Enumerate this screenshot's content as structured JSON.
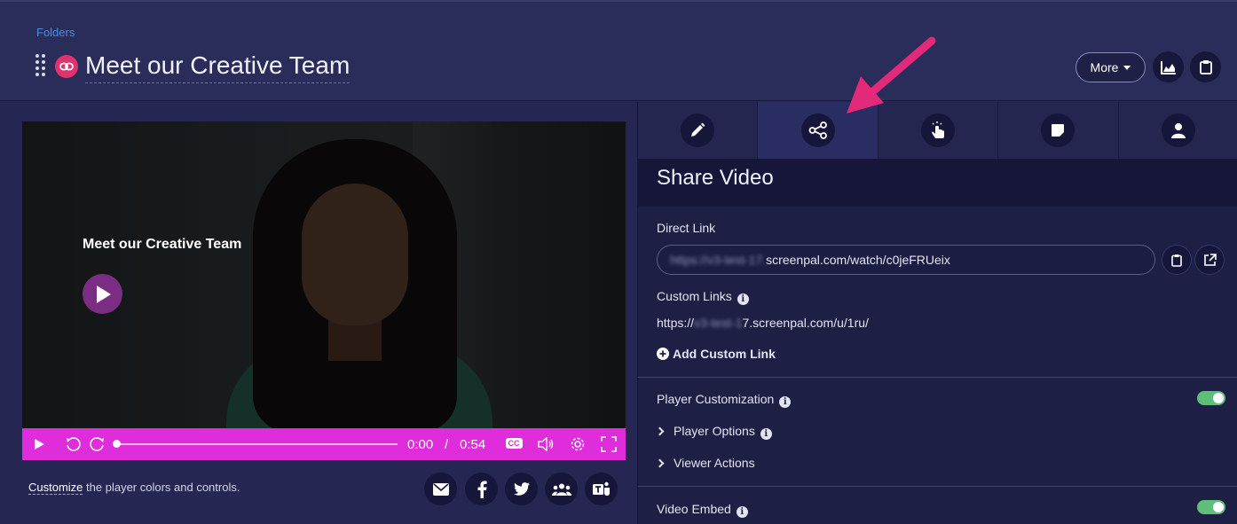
{
  "header": {
    "breadcrumb": "Folders",
    "title": "Meet our Creative Team",
    "more_label": "More"
  },
  "player": {
    "overlay_title": "Meet our Creative Team",
    "current_time": "0:00",
    "separator": "/",
    "duration": "0:54",
    "progress": 0,
    "cc_label": "CC",
    "bar_color": "#e02ddc"
  },
  "left_footer": {
    "customize_link": "Customize",
    "customize_rest": " the player colors and controls."
  },
  "share_buttons": [
    "email-icon",
    "facebook-icon",
    "twitter-icon",
    "group-icon",
    "teams-icon"
  ],
  "tabs": [
    {
      "icon": "pencil-icon",
      "active": false
    },
    {
      "icon": "share-icon",
      "active": true
    },
    {
      "icon": "hand-pointer-icon",
      "active": false
    },
    {
      "icon": "note-icon",
      "active": false
    },
    {
      "icon": "user-icon",
      "active": false
    }
  ],
  "share": {
    "section_title": "Share Video",
    "direct_link_label": "Direct Link",
    "direct_link_blurred": "https://v3-test-17.",
    "direct_link_visible": "screenpal.com/watch/c0jeFRUeix",
    "custom_links_label": "Custom Links",
    "custom_link_prefix": "https://",
    "custom_link_blurred": "v3-test-1",
    "custom_link_rest": "7.screenpal.com/u/1ru/",
    "add_custom_link": "Add Custom Link",
    "player_customization_label": "Player Customization",
    "player_customization_on": true,
    "player_options_label": "Player Options",
    "viewer_actions_label": "Viewer Actions",
    "video_embed_label": "Video Embed",
    "video_embed_on": true
  },
  "colors": {
    "accent_pink": "#e0336d",
    "arrow": "#e2297a",
    "toggle_on": "#5fbf7a",
    "link_blue": "#4a8fe0"
  }
}
